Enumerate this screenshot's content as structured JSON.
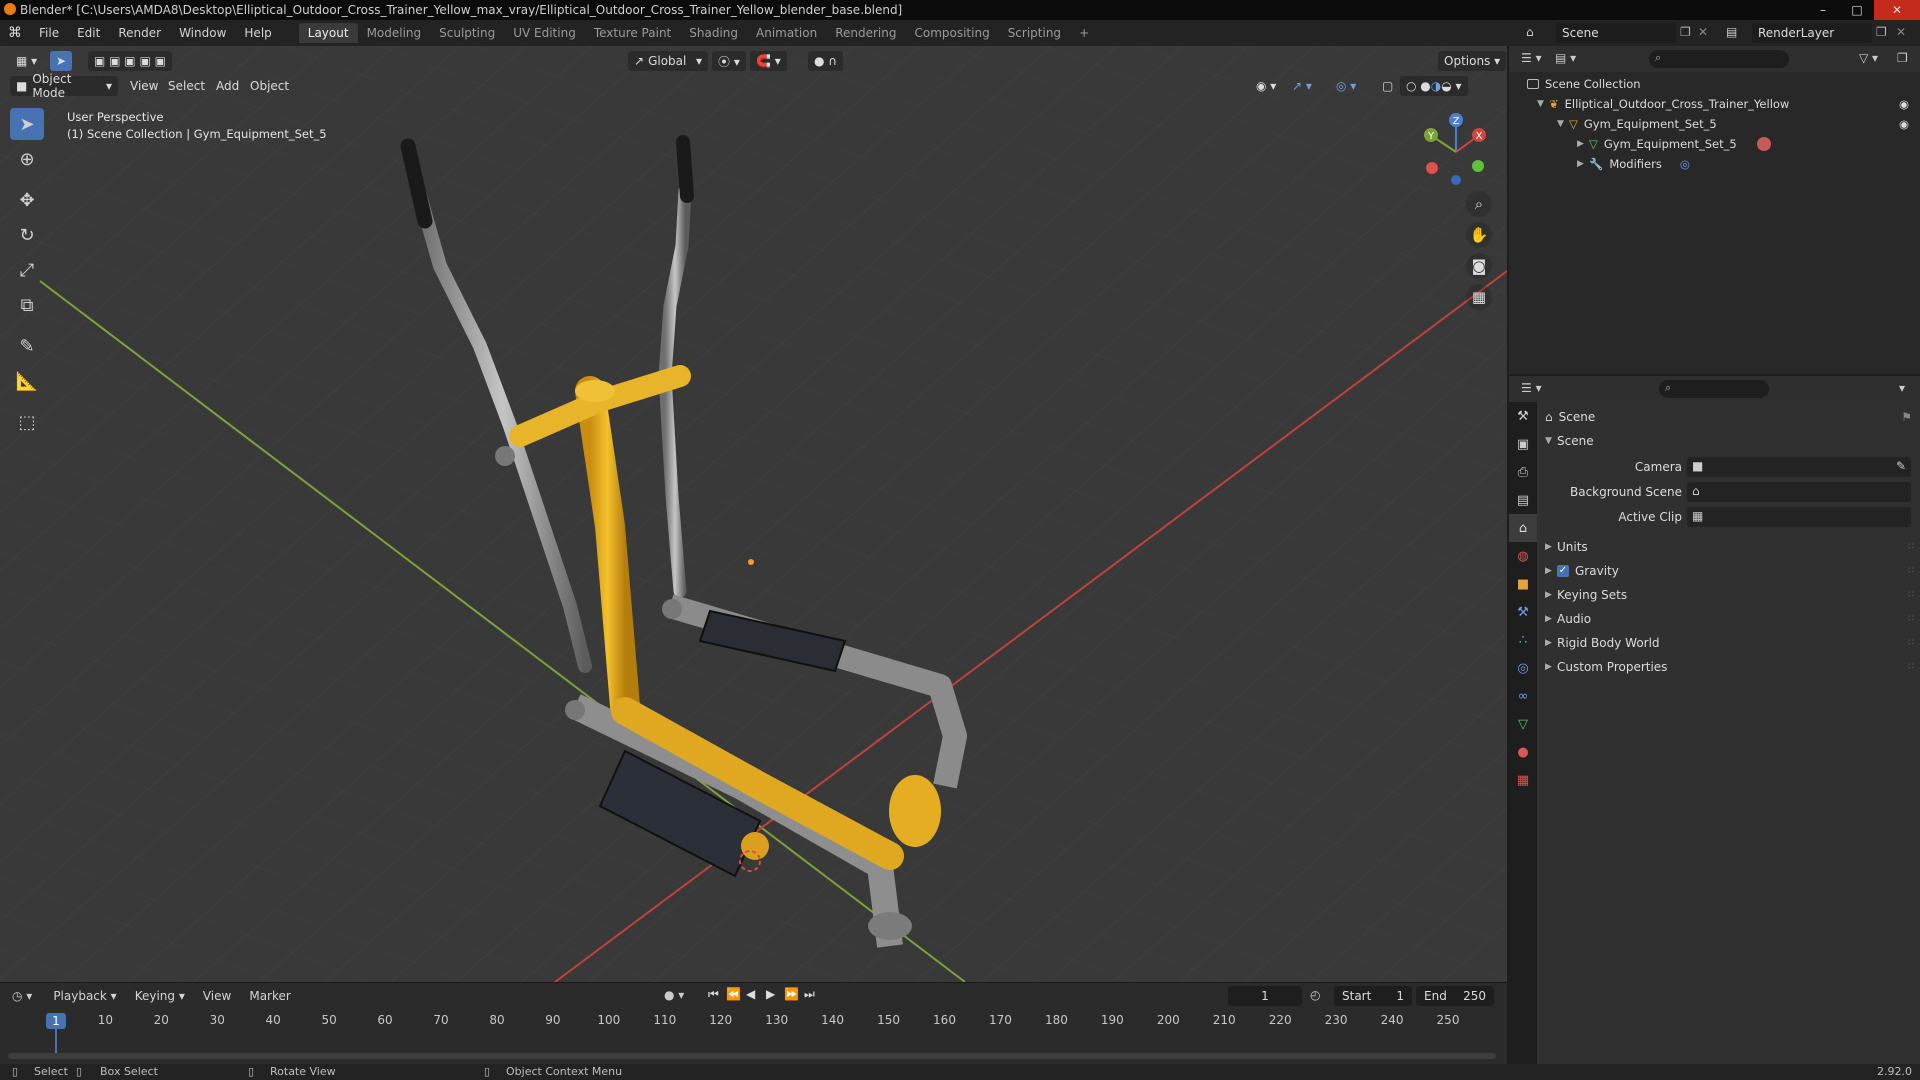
{
  "window": {
    "title": "Blender* [C:\\Users\\AMDA8\\Desktop\\Elliptical_Outdoor_Cross_Trainer_Yellow_max_vray/Elliptical_Outdoor_Cross_Trainer_Yellow_blender_base.blend]"
  },
  "menu": [
    "File",
    "Edit",
    "Render",
    "Window",
    "Help"
  ],
  "workspaces": [
    "Layout",
    "Modeling",
    "Sculpting",
    "UV Editing",
    "Texture Paint",
    "Shading",
    "Animation",
    "Rendering",
    "Compositing",
    "Scripting"
  ],
  "active_workspace": "Layout",
  "scene_name": "Scene",
  "view_layer": "RenderLayer",
  "viewport": {
    "mode": "Object Mode",
    "menus": [
      "View",
      "Select",
      "Add",
      "Object"
    ],
    "transform_orientation": "Global",
    "options_label": "Options",
    "perspective_label": "User Perspective",
    "collection_label": "(1) Scene Collection | Gym_Equipment_Set_5",
    "gizmo_axes": {
      "x": "X",
      "y": "Y",
      "z": "Z"
    }
  },
  "outliner": {
    "root": "Scene Collection",
    "items": [
      {
        "label": "Elliptical_Outdoor_Cross_Trainer_Yellow"
      },
      {
        "label": "Gym_Equipment_Set_5"
      },
      {
        "label": "Gym_Equipment_Set_5"
      },
      {
        "label": "Modifiers"
      }
    ]
  },
  "properties": {
    "context": "Scene",
    "section": "Scene",
    "fields": [
      {
        "label": "Camera"
      },
      {
        "label": "Background Scene"
      },
      {
        "label": "Active Clip"
      }
    ],
    "panels": [
      "Units",
      "Gravity",
      "Keying Sets",
      "Audio",
      "Rigid Body World",
      "Custom Properties"
    ],
    "gravity_checked": true
  },
  "timeline": {
    "menus": [
      "Playback",
      "Keying",
      "View",
      "Marker"
    ],
    "current_frame": "1",
    "start_label": "Start",
    "start": "1",
    "end_label": "End",
    "end": "250",
    "ruler": [
      "1",
      "10",
      "20",
      "30",
      "40",
      "50",
      "60",
      "70",
      "80",
      "90",
      "100",
      "110",
      "120",
      "130",
      "140",
      "150",
      "160",
      "170",
      "180",
      "190",
      "200",
      "210",
      "220",
      "230",
      "240",
      "250"
    ]
  },
  "statusbar": {
    "select": "Select",
    "box_select": "Box Select",
    "rotate_view": "Rotate View",
    "context_menu": "Object Context Menu",
    "version": "2.92.0"
  },
  "colors": {
    "accent": "#4772b3",
    "machine_yellow": "#e0a820",
    "metal_grey": "#9a9a9a",
    "axis_red": "#d0463c",
    "axis_green": "#7aa33a"
  }
}
